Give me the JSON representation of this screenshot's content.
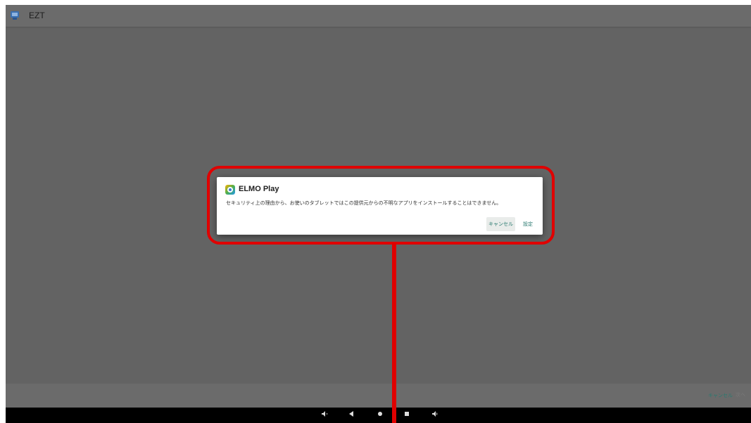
{
  "app": {
    "title": "EZT"
  },
  "dialog": {
    "title": "ELMO Play",
    "message": "セキュリティ上の理由から、お使いのタブレットではこの提供元からの不明なアプリをインストールすることはできません。",
    "cancel_label": "キャンセル",
    "settings_label": "設定"
  },
  "bottom_bar": {
    "cancel_label": "キャンセル",
    "other_label": "次へ"
  },
  "nav": {
    "volume_down": "volume-down-icon",
    "back": "back-icon",
    "home": "home-icon",
    "recents": "recents-icon",
    "volume_up": "volume-up-icon"
  },
  "colors": {
    "highlight": "#e00000",
    "accent": "#2a7a70",
    "overlay": "#636363"
  }
}
